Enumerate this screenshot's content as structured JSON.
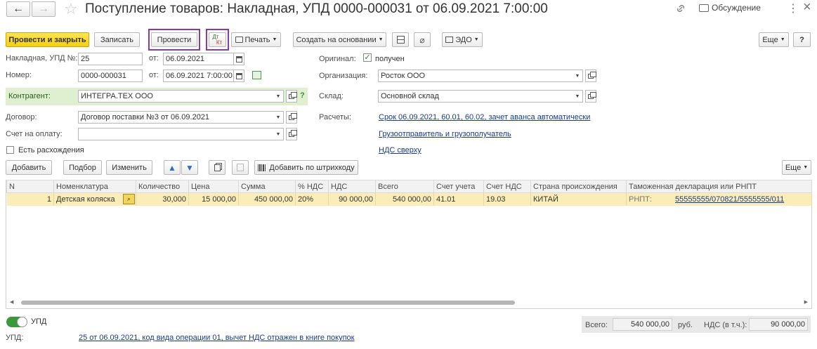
{
  "header": {
    "title": "Поступление товаров: Накладная, УПД 0000-000031 от 06.09.2021 7:00:00",
    "discussion_label": "Обсуждение",
    "more_symbol": "⋮",
    "close_symbol": "×"
  },
  "toolbar": {
    "post_close": "Провести и закрыть",
    "save": "Записать",
    "post": "Провести",
    "dtkt_dt": "Дт",
    "dtkt_kt": "Кт",
    "print": "Печать",
    "create_based": "Создать на основании",
    "edo": "ЭДО",
    "more": "Еще",
    "help": "?"
  },
  "form": {
    "invoice_label": "Накладная, УПД №:",
    "invoice_value": "25",
    "from_label": "от:",
    "invoice_date": "06.09.2021",
    "number_label": "Номер:",
    "number_value": "0000-000031",
    "number_date": "06.09.2021  7:00:00",
    "contractor_label": "Контрагент:",
    "contractor_value": "ИНТЕГРА.ТЕХ ООО",
    "contract_label": "Договор:",
    "contract_value": "Договор поставки №3 от 06.09.2021",
    "payment_label": "Счет на оплату:",
    "payment_value": "",
    "discrepancies_label": "Есть расхождения",
    "original_label": "Оригинал:",
    "original_value": "получен",
    "org_label": "Организация:",
    "org_value": "Росток ООО",
    "warehouse_label": "Склад:",
    "warehouse_value": "Основной склад",
    "settlements_label": "Расчеты:",
    "settlements_link": "Срок 06.09.2021, 60.01, 60.02, зачет аванса автоматически",
    "shipper_link": "Грузоотправитель и грузополучатель",
    "vat_link": "НДС сверху"
  },
  "table_toolbar": {
    "add": "Добавить",
    "pick": "Подбор",
    "edit": "Изменить",
    "barcode": "Добавить по штрихкоду",
    "more": "Еще"
  },
  "table": {
    "columns": [
      "N",
      "Номенклатура",
      "Количество",
      "Цена",
      "Сумма",
      "% НДС",
      "НДС",
      "Всего",
      "Счет учета",
      "Счет НДС",
      "Страна происхождения",
      "Таможенная декларация или РНПТ"
    ],
    "rows": [
      {
        "n": "1",
        "item": "Детская коляска",
        "qty": "30,000",
        "price": "15 000,00",
        "sum": "450 000,00",
        "vat_rate": "20%",
        "vat": "90 000,00",
        "total": "540 000,00",
        "account": "41.01",
        "vat_account": "19.03",
        "country": "КИТАЙ",
        "rnpt_prefix": "РНПТ:",
        "rnpt": "55555555/070821/5555555/011"
      }
    ]
  },
  "footer": {
    "upd_toggle_label": "УПД",
    "upd_label": "УПД:",
    "upd_link": "25 от 06.09.2021, код вида операции 01, вычет НДС отражен в книге покупок",
    "total_label": "Всего:",
    "total_value": "540 000,00",
    "currency": "руб.",
    "vat_label": "НДС (в т.ч.):",
    "vat_value": "90 000,00"
  },
  "colors": {
    "accent_yellow": "#f3cf15",
    "highlight_purple": "#8b3aa1",
    "selected_row": "#fbedb8",
    "link_blue": "#1a3a8f",
    "contractor_bg": "#dff0d0"
  }
}
